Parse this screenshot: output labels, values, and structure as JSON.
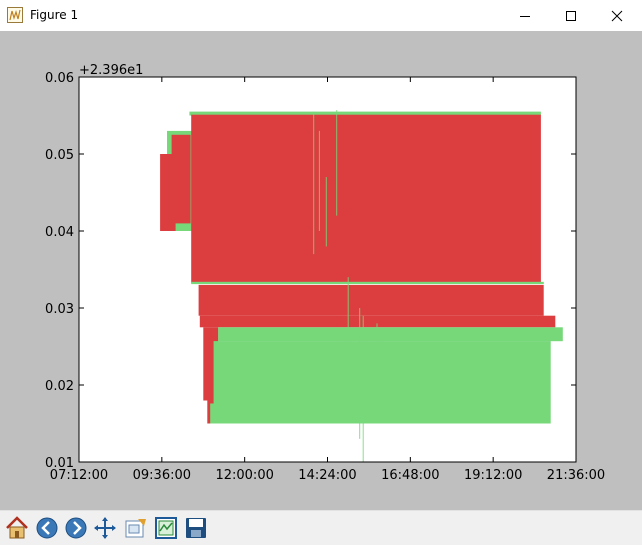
{
  "window": {
    "title": "Figure 1",
    "minimize_icon": "minimize-icon",
    "maximize_icon": "maximize-icon",
    "close_icon": "close-icon"
  },
  "toolbar": {
    "buttons": [
      {
        "name": "home-button",
        "icon": "home-icon"
      },
      {
        "name": "back-button",
        "icon": "back-arrow-icon"
      },
      {
        "name": "forward-button",
        "icon": "forward-arrow-icon"
      },
      {
        "name": "pan-button",
        "icon": "move-arrows-icon"
      },
      {
        "name": "zoom-button",
        "icon": "zoom-rect-icon"
      },
      {
        "name": "configure-subplots-button",
        "icon": "subplots-icon"
      },
      {
        "name": "save-button",
        "icon": "save-disk-icon"
      }
    ]
  },
  "chart_data": {
    "type": "bar",
    "title": "",
    "xlabel": "",
    "ylabel": "",
    "y_offset_label": "+2.396e1",
    "x_ticks": [
      "07:12:00",
      "09:36:00",
      "12:00:00",
      "14:24:00",
      "16:48:00",
      "19:12:00",
      "21:36:00"
    ],
    "y_ticks": [
      "0.01",
      "0.02",
      "0.03",
      "0.04",
      "0.05",
      "0.06"
    ],
    "xlim": [
      "07:12:00",
      "21:36:00"
    ],
    "ylim": [
      0.01,
      0.06
    ],
    "grid": false,
    "legend": "none",
    "colors": {
      "up": "#77d87a",
      "down": "#dc3e40",
      "background": "#bfbfbf",
      "axes_face": "#ffffff"
    },
    "bars": [
      {
        "color": "up",
        "x_start": "09:45:00",
        "x_end": "10:30:00",
        "y_low": 0.04,
        "y_high": 0.053
      },
      {
        "color": "down",
        "x_start": "09:33:00",
        "x_end": "10:00:00",
        "y_low": 0.04,
        "y_high": 0.05
      },
      {
        "color": "down",
        "x_start": "09:53:00",
        "x_end": "10:26:00",
        "y_low": 0.041,
        "y_high": 0.0525
      },
      {
        "color": "up",
        "x_start": "10:24:00",
        "x_end": "20:35:00",
        "y_low": 0.055,
        "y_high": 0.0555
      },
      {
        "color": "down",
        "x_start": "10:27:00",
        "x_end": "20:35:00",
        "y_low": 0.0332,
        "y_high": 0.0551
      },
      {
        "color": "up",
        "x_start": "10:27:00",
        "x_end": "20:40:00",
        "y_low": 0.0331,
        "y_high": 0.0334
      },
      {
        "color": "down",
        "x_start": "10:40:00",
        "x_end": "20:40:00",
        "y_low": 0.029,
        "y_high": 0.033
      },
      {
        "color": "down",
        "x_start": "10:42:00",
        "x_end": "21:00:00",
        "y_low": 0.0275,
        "y_high": 0.029
      },
      {
        "color": "down",
        "x_start": "10:48:00",
        "x_end": "11:14:00",
        "y_low": 0.018,
        "y_high": 0.0275
      },
      {
        "color": "down",
        "x_start": "10:55:00",
        "x_end": "11:14:00",
        "y_low": 0.015,
        "y_high": 0.018
      },
      {
        "color": "up",
        "x_start": "11:14:00",
        "x_end": "21:13:00",
        "y_low": 0.0257,
        "y_high": 0.0275
      },
      {
        "color": "up",
        "x_start": "11:06:00",
        "x_end": "20:52:00",
        "y_low": 0.0176,
        "y_high": 0.0257
      },
      {
        "color": "up",
        "x_start": "11:00:00",
        "x_end": "20:52:00",
        "y_low": 0.015,
        "y_high": 0.0176
      }
    ],
    "wicks": [
      {
        "color": "up",
        "x": "14:00:00",
        "y_low": 0.037,
        "y_high": 0.0555
      },
      {
        "color": "up",
        "x": "14:10:00",
        "y_low": 0.04,
        "y_high": 0.053
      },
      {
        "color": "up",
        "x": "14:22:00",
        "y_low": 0.038,
        "y_high": 0.047
      },
      {
        "color": "up",
        "x": "14:40:00",
        "y_low": 0.042,
        "y_high": 0.0557
      },
      {
        "color": "up",
        "x": "15:00:00",
        "y_low": 0.02,
        "y_high": 0.034
      },
      {
        "color": "up",
        "x": "15:20:00",
        "y_low": 0.013,
        "y_high": 0.03
      },
      {
        "color": "up",
        "x": "15:26:00",
        "y_low": 0.01,
        "y_high": 0.029
      },
      {
        "color": "up",
        "x": "15:50:00",
        "y_low": 0.022,
        "y_high": 0.028
      }
    ]
  }
}
